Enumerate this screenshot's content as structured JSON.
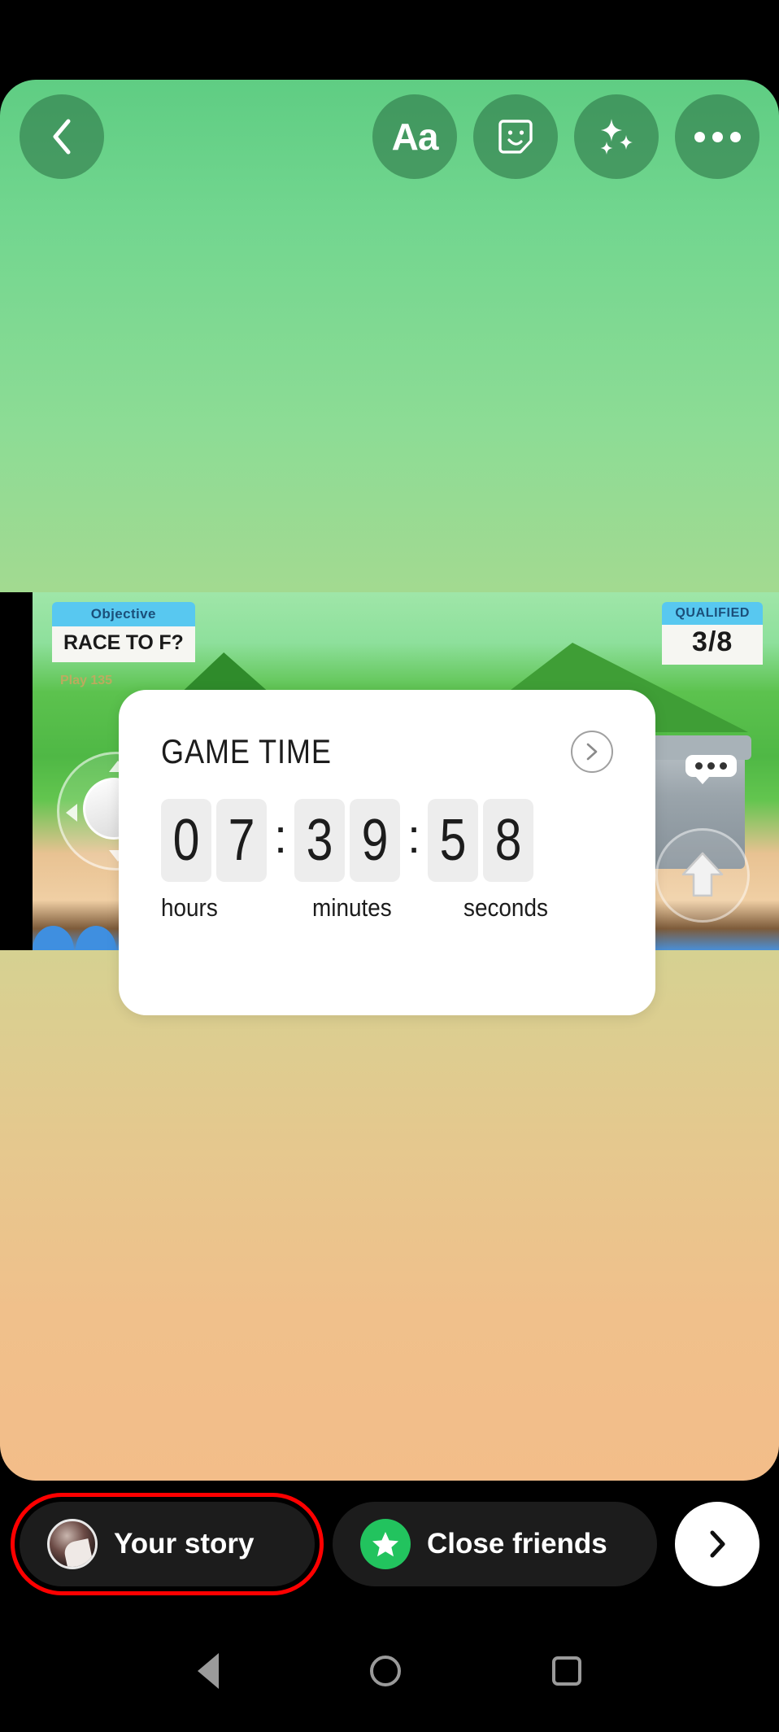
{
  "app": {
    "screen_name": "Instagram Story Editor"
  },
  "toolbar": {
    "back": {
      "label": "Back",
      "icon": "chevron-left-icon"
    },
    "actions": [
      {
        "name": "text-tool",
        "label": "Aa",
        "icon": "text-aa-icon"
      },
      {
        "name": "sticker-tool",
        "label": "Stickers",
        "icon": "sticker-smiley-icon"
      },
      {
        "name": "effects-tool",
        "label": "Effects",
        "icon": "sparkles-icon"
      },
      {
        "name": "more-options",
        "label": "More",
        "icon": "three-dots-icon"
      }
    ]
  },
  "story_canvas": {
    "background_top_color": "#5fcd83",
    "background_bottom_color": "#f3bd89"
  },
  "game_capture": {
    "objective_tab": "Objective",
    "objective_text": "RACE TO F?",
    "sub_label": "Play 135",
    "qualified_tab": "QUALIFIED",
    "qualified_count": "3/8",
    "joystick_name": "movement-joystick",
    "jump_button_name": "jump-button",
    "chat_bubble_name": "chat-bubble-icon"
  },
  "countdown_sticker": {
    "title": "GAME TIME",
    "next_icon": "chevron-right-circle-icon",
    "hours": [
      "0",
      "7"
    ],
    "minutes": [
      "3",
      "9"
    ],
    "seconds": [
      "5",
      "8"
    ],
    "separator": ":",
    "labels": {
      "hours": "hours",
      "minutes": "minutes",
      "seconds": "seconds"
    },
    "card_color": "#ffffff",
    "digit_bg_color": "#ededed"
  },
  "share_bar": {
    "your_story": {
      "label": "Your story",
      "avatar_name": "user-avatar",
      "highlighted": true,
      "highlight_color": "#ff0000"
    },
    "close_friends": {
      "label": "Close friends",
      "icon": "green-star-icon",
      "icon_color": "#22c35e"
    },
    "next_button": {
      "label": "Next",
      "icon": "chevron-right-icon"
    }
  },
  "system_nav": {
    "back": "back-triangle-icon",
    "home": "home-circle-icon",
    "recents": "recents-square-icon"
  }
}
